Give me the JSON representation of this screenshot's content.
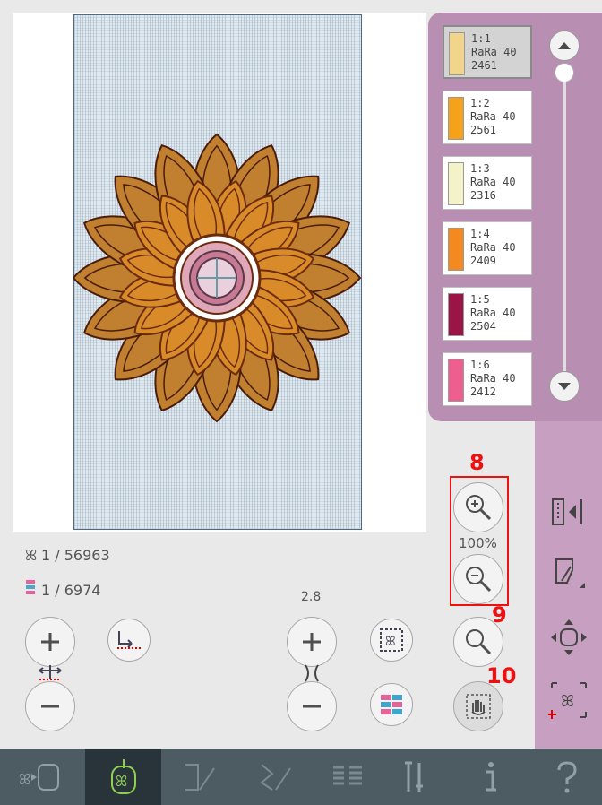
{
  "thread_colors": [
    {
      "pos": "1:1",
      "brand": "RaRa 40",
      "code": "2461",
      "color": "#f1d58a",
      "selected": true
    },
    {
      "pos": "1:2",
      "brand": "RaRa 40",
      "code": "2561",
      "color": "#f5a21a",
      "selected": false
    },
    {
      "pos": "1:3",
      "brand": "RaRa 40",
      "code": "2316",
      "color": "#f4f2c8",
      "selected": false
    },
    {
      "pos": "1:4",
      "brand": "RaRa 40",
      "code": "2409",
      "color": "#f4891f",
      "selected": false
    },
    {
      "pos": "1:5",
      "brand": "RaRa 40",
      "code": "2504",
      "color": "#9b1446",
      "selected": false
    },
    {
      "pos": "1:6",
      "brand": "RaRa 40",
      "code": "2412",
      "color": "#ee5f8f",
      "selected": false
    }
  ],
  "stats": {
    "stitch_count": "1 / 56963",
    "color_block": "1 / 6974"
  },
  "controls": {
    "tension_value": "2.8",
    "zoom_value": "100%"
  },
  "callouts": {
    "zoom_group": "8",
    "zoom_to_fit": "9",
    "pan": "10"
  },
  "colors": {
    "accent": "#b88fb3",
    "taskbar": "#4d5b62",
    "active_task": "#8fd14f",
    "callout": "#ee1111"
  }
}
